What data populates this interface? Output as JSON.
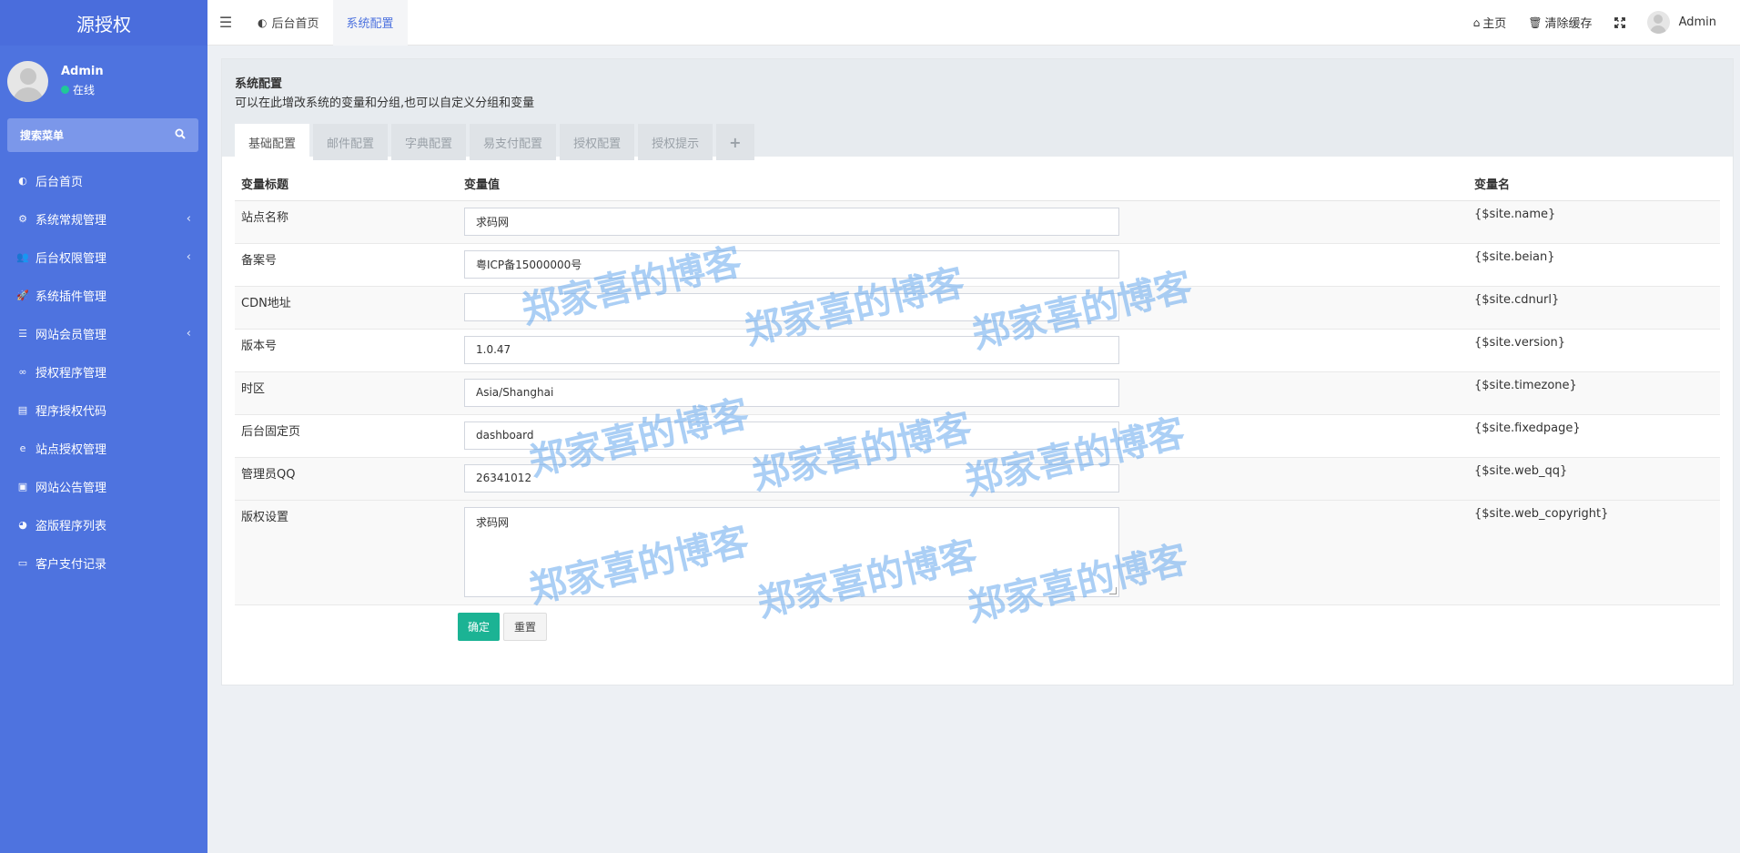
{
  "sidebar": {
    "logo": "源授权",
    "user": {
      "name": "Admin",
      "status": "在线"
    },
    "search_placeholder": "搜索菜单",
    "items": [
      {
        "label": "后台首页",
        "icon": "dashboard-icon",
        "glyph": "◐",
        "has_arrow": false
      },
      {
        "label": "系统常规管理",
        "icon": "cogs-icon",
        "glyph": "⚙",
        "has_arrow": true
      },
      {
        "label": "后台权限管理",
        "icon": "users-icon",
        "glyph": "👥",
        "has_arrow": true
      },
      {
        "label": "系统插件管理",
        "icon": "rocket-icon",
        "glyph": "🚀",
        "has_arrow": false
      },
      {
        "label": "网站会员管理",
        "icon": "list-icon",
        "glyph": "☰",
        "has_arrow": true
      },
      {
        "label": "授权程序管理",
        "icon": "pied-piper-icon",
        "glyph": "∞",
        "has_arrow": false
      },
      {
        "label": "程序授权代码",
        "icon": "id-card-icon",
        "glyph": "▤",
        "has_arrow": false
      },
      {
        "label": "站点授权管理",
        "icon": "ie-icon",
        "glyph": "e",
        "has_arrow": false
      },
      {
        "label": "网站公告管理",
        "icon": "notice-icon",
        "glyph": "▣",
        "has_arrow": false
      },
      {
        "label": "盗版程序列表",
        "icon": "drupal-icon",
        "glyph": "◕",
        "has_arrow": false
      },
      {
        "label": "客户支付记录",
        "icon": "cc-icon",
        "glyph": "▭",
        "has_arrow": false
      }
    ]
  },
  "header": {
    "tabs": [
      {
        "label": "后台首页",
        "icon": "dashboard-icon",
        "glyph": "◐",
        "active": false
      },
      {
        "label": "系统配置",
        "active": true
      }
    ],
    "home": "主页",
    "clear_cache": "清除缓存",
    "username": "Admin"
  },
  "panel": {
    "title": "系统配置",
    "description": "可以在此增改系统的变量和分组,也可以自定义分组和变量",
    "tabs": [
      "基础配置",
      "邮件配置",
      "字典配置",
      "易支付配置",
      "授权配置",
      "授权提示"
    ],
    "plus": "+",
    "columns": {
      "title": "变量标题",
      "value": "变量值",
      "name": "变量名"
    },
    "rows": [
      {
        "title": "站点名称",
        "value": "求码网",
        "name": "{$site.name}"
      },
      {
        "title": "备案号",
        "value": "粤ICP备15000000号",
        "name": "{$site.beian}"
      },
      {
        "title": "CDN地址",
        "value": "",
        "name": "{$site.cdnurl}"
      },
      {
        "title": "版本号",
        "value": "1.0.47",
        "name": "{$site.version}"
      },
      {
        "title": "时区",
        "value": "Asia/Shanghai",
        "name": "{$site.timezone}"
      },
      {
        "title": "后台固定页",
        "value": "dashboard",
        "name": "{$site.fixedpage}"
      },
      {
        "title": "管理员QQ",
        "value": "26341012",
        "name": "{$site.web_qq}"
      }
    ],
    "copyright": {
      "title": "版权设置",
      "value": "求码网",
      "name": "{$site.web_copyright}"
    },
    "ok_button": "确定",
    "reset_button": "重置"
  },
  "watermark": "郑家喜的博客",
  "colors": {
    "sidebar": "#4e73df",
    "accent": "#4e73df",
    "ok": "#1bb394"
  }
}
